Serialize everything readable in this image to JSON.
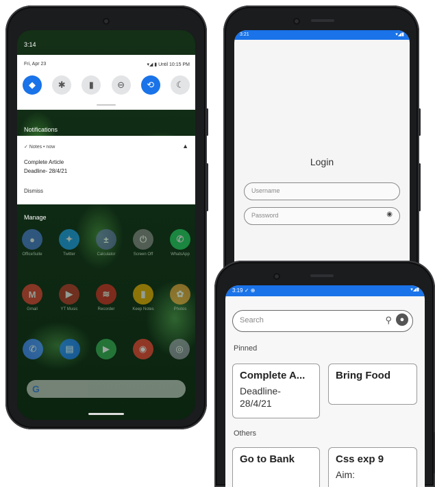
{
  "phone1": {
    "time": "3:14",
    "date": "Fri, Apr 23",
    "battery_status": "Until 10:15 PM",
    "quick_tiles": [
      {
        "icon": "wifi-icon",
        "glyph": "◆",
        "on": true
      },
      {
        "icon": "bluetooth-icon",
        "glyph": "✱",
        "on": false
      },
      {
        "icon": "flashlight-icon",
        "glyph": "▮",
        "on": false
      },
      {
        "icon": "dnd-icon",
        "glyph": "⊖",
        "on": false
      },
      {
        "icon": "autorotate-icon",
        "glyph": "⟲",
        "on": true
      },
      {
        "icon": "dark-theme-icon",
        "glyph": "☾",
        "on": false
      }
    ],
    "notifications_label": "Notifications",
    "notification": {
      "app": "✓  Notes • now",
      "title": "Complete Article",
      "body": "Deadline- 28/4/21",
      "dismiss": "Dismiss"
    },
    "manage_label": "Manage",
    "apps_row1": [
      {
        "name": "OfficeSuite",
        "color": "#4a7bd4",
        "glyph": "●"
      },
      {
        "name": "Twitter",
        "color": "#1da1f2",
        "glyph": "✦"
      },
      {
        "name": "Calculator",
        "color": "#5a6aa0",
        "glyph": "±"
      },
      {
        "name": "Screen Off",
        "color": "#8a8a8a",
        "glyph": "⏻"
      },
      {
        "name": "WhatsApp",
        "color": "#25d366",
        "glyph": "✆"
      }
    ],
    "apps_row2": [
      {
        "name": "Gmail",
        "color": "#e94335",
        "glyph": "M"
      },
      {
        "name": "YT Music",
        "color": "#c0392b",
        "glyph": "▶"
      },
      {
        "name": "Recorder",
        "color": "#d93025",
        "glyph": "≋"
      },
      {
        "name": "Keep Notes",
        "color": "#f4b400",
        "glyph": "▮"
      },
      {
        "name": "Photos",
        "color": "#e8a13a",
        "glyph": "✿"
      }
    ],
    "dock": [
      {
        "name": "phone",
        "color": "#4285f4",
        "glyph": "✆"
      },
      {
        "name": "messages",
        "color": "#1a73e8",
        "glyph": "▤"
      },
      {
        "name": "play store",
        "color": "#34a853",
        "glyph": "▶"
      },
      {
        "name": "chrome",
        "color": "#ea4335",
        "glyph": "◉"
      },
      {
        "name": "camera",
        "color": "#8a8f99",
        "glyph": "◎"
      }
    ],
    "google_bar": "G"
  },
  "phone2": {
    "time": "3:21",
    "status_icons": "▾◢▮",
    "login_title": "Login",
    "username_placeholder": "Username",
    "password_placeholder": "Password",
    "eye_glyph": "◉"
  },
  "phone3": {
    "time": "3:19  ✓  ⊕",
    "status_icons": "▾◢▮",
    "search_placeholder": "Search",
    "pinned_label": "Pinned",
    "others_label": "Others",
    "pinned": [
      {
        "title": "Complete A...",
        "body": "Deadline-\n28/4/21"
      },
      {
        "title": "Bring Food",
        "body": ""
      }
    ],
    "others": [
      {
        "title": "Go to Bank",
        "body": ""
      },
      {
        "title": "Css exp 9",
        "body": "Aim:"
      }
    ]
  }
}
